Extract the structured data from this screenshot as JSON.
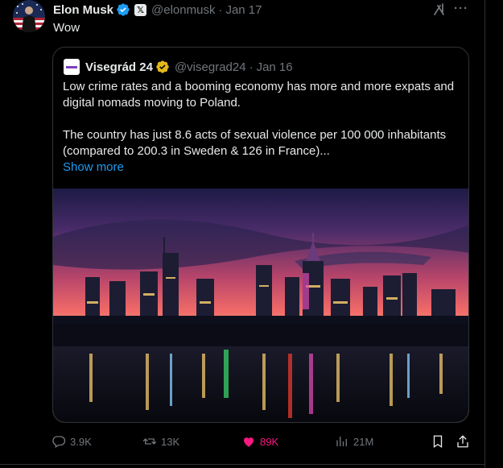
{
  "tweet": {
    "author_name": "Elon Musk",
    "handle": "@elonmusk",
    "separator": "·",
    "time": "Jan 17",
    "text": "Wow",
    "x_badge_glyph": "𝕏"
  },
  "quote": {
    "author_name": "Visegrád 24",
    "handle": "@visegrad24",
    "separator": "·",
    "time": "Jan 16",
    "paragraph_1": "Low crime rates and a booming economy has more and more expats and digital nomads moving to Poland.",
    "paragraph_2": "The country has just 8.6 acts of sexual violence per 100 000 inhabitants (compared to 200.3 in Sweden & 126 in France)...",
    "show_more": "Show more"
  },
  "actions": {
    "replies": "3.9K",
    "reposts": "13K",
    "likes": "89K",
    "views": "21M"
  },
  "icons": [
    "avatar",
    "verified-badge-icon",
    "x-affiliate-badge-icon",
    "grok-icon",
    "more-options-icon",
    "reply-icon",
    "repost-icon",
    "like-icon",
    "views-icon",
    "bookmark-icon",
    "share-icon"
  ],
  "colors": {
    "background": "#000000",
    "text": "#e7e9ea",
    "muted": "#71767b",
    "link": "#1d9bf0",
    "like": "#f91880",
    "verified_blue": "#1d9bf0",
    "verified_gold": "#e2b719",
    "border": "#2f3336"
  }
}
